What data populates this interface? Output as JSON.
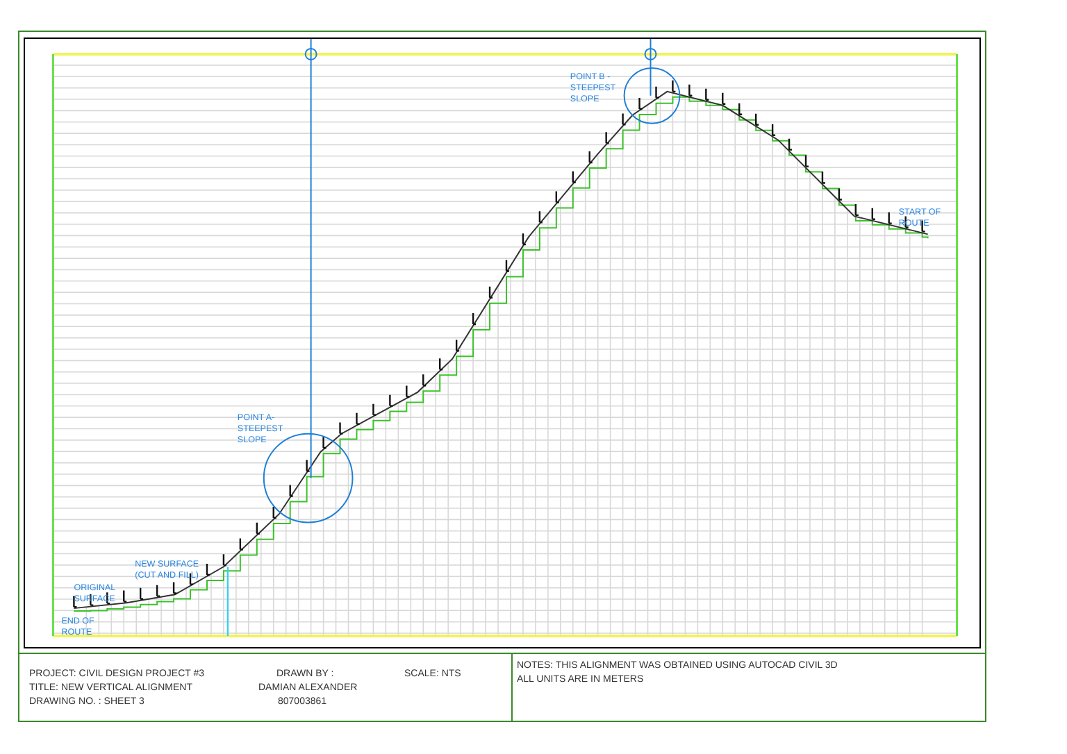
{
  "drawing": {
    "labels": [
      {
        "lines": [
          "POINT B -",
          "STEEPEST",
          "SLOPE"
        ]
      },
      {
        "lines": [
          "START OF",
          "ROUTE"
        ]
      },
      {
        "lines": [
          "POINT A-",
          "STEEPEST",
          "SLOPE"
        ]
      },
      {
        "lines": [
          "NEW SURFACE",
          "(CUT AND FILL)"
        ]
      },
      {
        "lines": [
          "ORIGINAL",
          "SURFACE"
        ]
      },
      {
        "lines": [
          "END OF",
          "ROUTE"
        ]
      }
    ]
  },
  "title_block": {
    "project": "PROJECT: CIVIL DESIGN PROJECT #3",
    "title": "TITLE: NEW VERTICAL ALIGNMENT",
    "drawing_no": "DRAWING NO. : SHEET 3",
    "drawn_by_label": "DRAWN BY :",
    "drawn_by_name": "DAMIAN ALEXANDER",
    "drawn_by_id": "807003861",
    "scale": "SCALE: NTS",
    "notes": [
      "NOTES: THIS ALIGNMENT WAS OBTAINED USING AUTOCAD CIVIL 3D",
      "ALL UNITS ARE IN METERS"
    ]
  }
}
